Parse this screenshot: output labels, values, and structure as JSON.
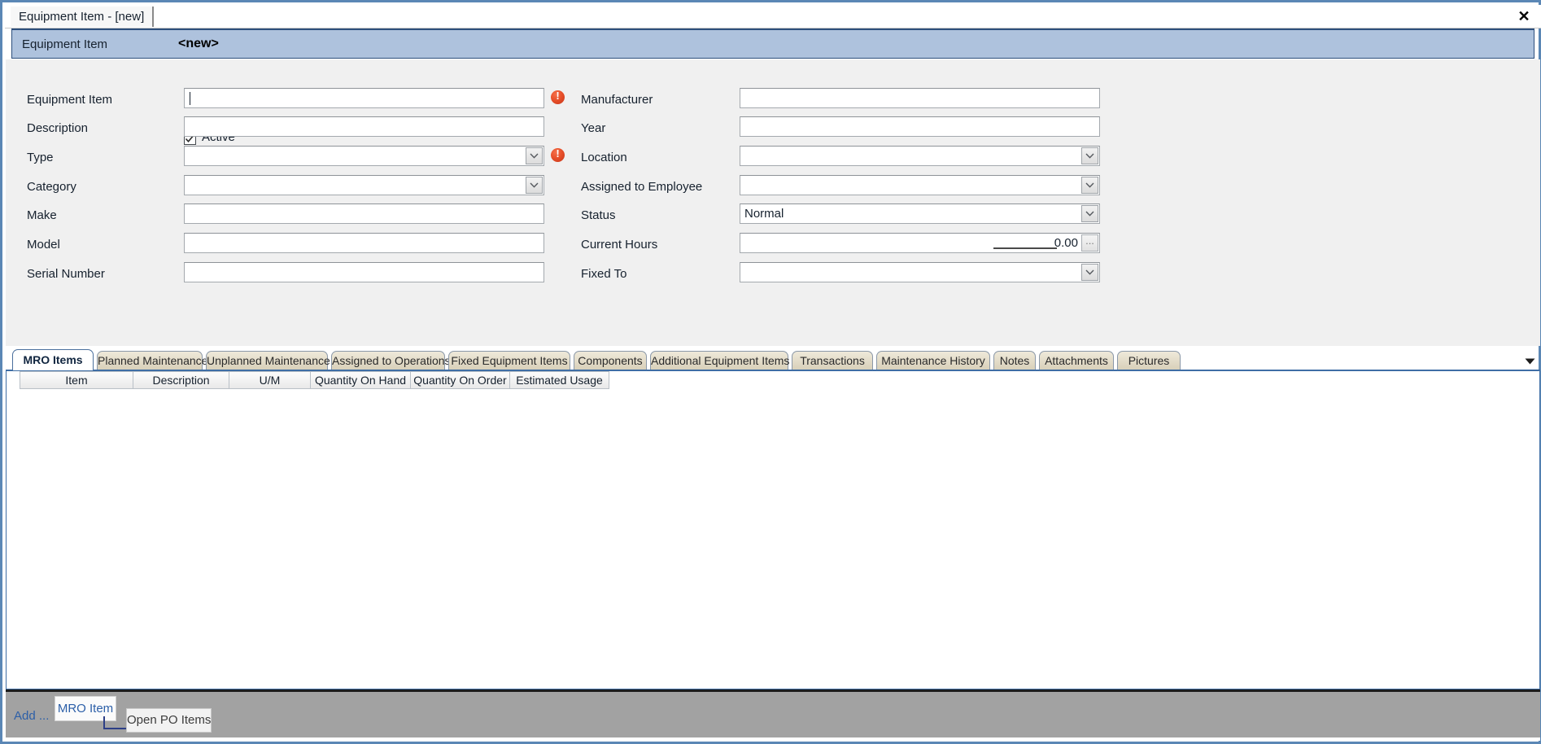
{
  "window": {
    "doc_tab_label": "Equipment Item - [new]",
    "close_icon": "close-icon"
  },
  "header": {
    "label": "Equipment Item",
    "value": "<new>"
  },
  "form": {
    "active": {
      "label": "Active",
      "checked": true
    },
    "left_fields": [
      {
        "label": "Equipment Item",
        "value": "",
        "kind": "text",
        "required": true,
        "focused": true
      },
      {
        "label": "Description",
        "value": "",
        "kind": "text",
        "required": false
      },
      {
        "label": "Type",
        "value": "",
        "kind": "combo",
        "required": true
      },
      {
        "label": "Category",
        "value": "",
        "kind": "combo",
        "required": false
      },
      {
        "label": "Make",
        "value": "",
        "kind": "text",
        "required": false
      },
      {
        "label": "Model",
        "value": "",
        "kind": "text",
        "required": false
      },
      {
        "label": "Serial Number",
        "value": "",
        "kind": "text",
        "required": false
      }
    ],
    "right_fields": [
      {
        "label": "Manufacturer",
        "value": "",
        "kind": "text",
        "required": false
      },
      {
        "label": "Year",
        "value": "",
        "kind": "text",
        "required": false
      },
      {
        "label": "Location",
        "value": "",
        "kind": "combo",
        "required": false
      },
      {
        "label": "Assigned to Employee",
        "value": "",
        "kind": "combo",
        "required": false
      },
      {
        "label": "Status",
        "value": "Normal",
        "kind": "combo",
        "required": false
      },
      {
        "label": "Current Hours",
        "value": "0.00",
        "kind": "number",
        "required": false
      },
      {
        "label": "Fixed To",
        "value": "",
        "kind": "combo",
        "required": false
      }
    ]
  },
  "tabs": {
    "active_index": 0,
    "overflow_icon": "chevron-down-icon",
    "items": [
      {
        "label": "MRO Items"
      },
      {
        "label": "Planned Maintenance"
      },
      {
        "label": "Unplanned Maintenance"
      },
      {
        "label": "Assigned to Operations"
      },
      {
        "label": "Fixed Equipment Items"
      },
      {
        "label": "Components"
      },
      {
        "label": "Additional Equipment Items"
      },
      {
        "label": "Transactions"
      },
      {
        "label": "Maintenance History"
      },
      {
        "label": "Notes"
      },
      {
        "label": "Attachments"
      },
      {
        "label": "Pictures"
      }
    ]
  },
  "grid": {
    "columns": [
      "Item",
      "Description",
      "U/M",
      "Quantity On Hand",
      "Quantity On Order",
      "Estimated Usage"
    ],
    "rows": []
  },
  "action_bar": {
    "add_label": "Add ...",
    "mro_item_label": "MRO Item",
    "open_po_label": "Open PO Items"
  },
  "colors": {
    "header_band": "#aec2dd",
    "header_border": "#2d4f7c",
    "window_border": "#5b87b5",
    "form_bg": "#f0f0f0",
    "tab_inactive": "#ded5be",
    "action_bar": "#a2a2a2",
    "accent_link": "#2c5fa8",
    "error_red": "#e8502a"
  }
}
